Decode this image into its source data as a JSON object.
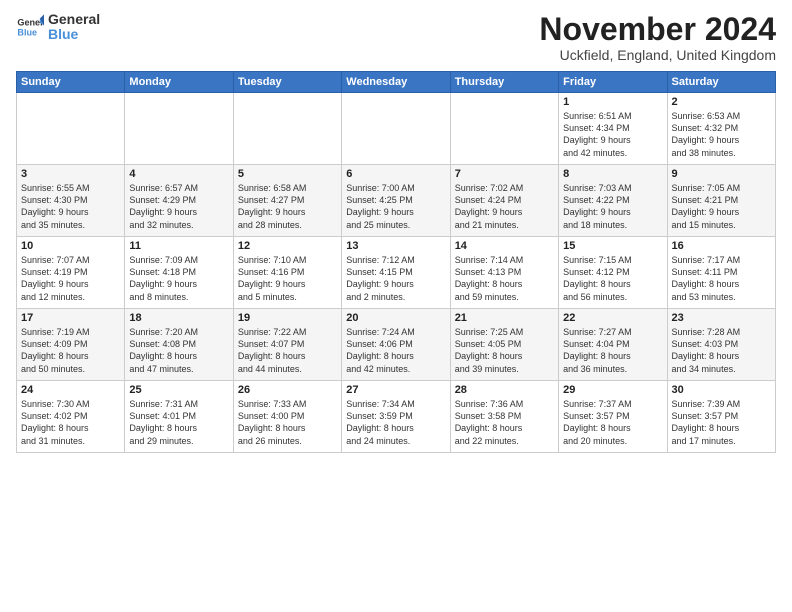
{
  "logo": {
    "line1": "General",
    "line2": "Blue"
  },
  "title": "November 2024",
  "subtitle": "Uckfield, England, United Kingdom",
  "header": {
    "days": [
      "Sunday",
      "Monday",
      "Tuesday",
      "Wednesday",
      "Thursday",
      "Friday",
      "Saturday"
    ]
  },
  "weeks": [
    [
      {
        "day": "",
        "info": ""
      },
      {
        "day": "",
        "info": ""
      },
      {
        "day": "",
        "info": ""
      },
      {
        "day": "",
        "info": ""
      },
      {
        "day": "",
        "info": ""
      },
      {
        "day": "1",
        "info": "Sunrise: 6:51 AM\nSunset: 4:34 PM\nDaylight: 9 hours\nand 42 minutes."
      },
      {
        "day": "2",
        "info": "Sunrise: 6:53 AM\nSunset: 4:32 PM\nDaylight: 9 hours\nand 38 minutes."
      }
    ],
    [
      {
        "day": "3",
        "info": "Sunrise: 6:55 AM\nSunset: 4:30 PM\nDaylight: 9 hours\nand 35 minutes."
      },
      {
        "day": "4",
        "info": "Sunrise: 6:57 AM\nSunset: 4:29 PM\nDaylight: 9 hours\nand 32 minutes."
      },
      {
        "day": "5",
        "info": "Sunrise: 6:58 AM\nSunset: 4:27 PM\nDaylight: 9 hours\nand 28 minutes."
      },
      {
        "day": "6",
        "info": "Sunrise: 7:00 AM\nSunset: 4:25 PM\nDaylight: 9 hours\nand 25 minutes."
      },
      {
        "day": "7",
        "info": "Sunrise: 7:02 AM\nSunset: 4:24 PM\nDaylight: 9 hours\nand 21 minutes."
      },
      {
        "day": "8",
        "info": "Sunrise: 7:03 AM\nSunset: 4:22 PM\nDaylight: 9 hours\nand 18 minutes."
      },
      {
        "day": "9",
        "info": "Sunrise: 7:05 AM\nSunset: 4:21 PM\nDaylight: 9 hours\nand 15 minutes."
      }
    ],
    [
      {
        "day": "10",
        "info": "Sunrise: 7:07 AM\nSunset: 4:19 PM\nDaylight: 9 hours\nand 12 minutes."
      },
      {
        "day": "11",
        "info": "Sunrise: 7:09 AM\nSunset: 4:18 PM\nDaylight: 9 hours\nand 8 minutes."
      },
      {
        "day": "12",
        "info": "Sunrise: 7:10 AM\nSunset: 4:16 PM\nDaylight: 9 hours\nand 5 minutes."
      },
      {
        "day": "13",
        "info": "Sunrise: 7:12 AM\nSunset: 4:15 PM\nDaylight: 9 hours\nand 2 minutes."
      },
      {
        "day": "14",
        "info": "Sunrise: 7:14 AM\nSunset: 4:13 PM\nDaylight: 8 hours\nand 59 minutes."
      },
      {
        "day": "15",
        "info": "Sunrise: 7:15 AM\nSunset: 4:12 PM\nDaylight: 8 hours\nand 56 minutes."
      },
      {
        "day": "16",
        "info": "Sunrise: 7:17 AM\nSunset: 4:11 PM\nDaylight: 8 hours\nand 53 minutes."
      }
    ],
    [
      {
        "day": "17",
        "info": "Sunrise: 7:19 AM\nSunset: 4:09 PM\nDaylight: 8 hours\nand 50 minutes."
      },
      {
        "day": "18",
        "info": "Sunrise: 7:20 AM\nSunset: 4:08 PM\nDaylight: 8 hours\nand 47 minutes."
      },
      {
        "day": "19",
        "info": "Sunrise: 7:22 AM\nSunset: 4:07 PM\nDaylight: 8 hours\nand 44 minutes."
      },
      {
        "day": "20",
        "info": "Sunrise: 7:24 AM\nSunset: 4:06 PM\nDaylight: 8 hours\nand 42 minutes."
      },
      {
        "day": "21",
        "info": "Sunrise: 7:25 AM\nSunset: 4:05 PM\nDaylight: 8 hours\nand 39 minutes."
      },
      {
        "day": "22",
        "info": "Sunrise: 7:27 AM\nSunset: 4:04 PM\nDaylight: 8 hours\nand 36 minutes."
      },
      {
        "day": "23",
        "info": "Sunrise: 7:28 AM\nSunset: 4:03 PM\nDaylight: 8 hours\nand 34 minutes."
      }
    ],
    [
      {
        "day": "24",
        "info": "Sunrise: 7:30 AM\nSunset: 4:02 PM\nDaylight: 8 hours\nand 31 minutes."
      },
      {
        "day": "25",
        "info": "Sunrise: 7:31 AM\nSunset: 4:01 PM\nDaylight: 8 hours\nand 29 minutes."
      },
      {
        "day": "26",
        "info": "Sunrise: 7:33 AM\nSunset: 4:00 PM\nDaylight: 8 hours\nand 26 minutes."
      },
      {
        "day": "27",
        "info": "Sunrise: 7:34 AM\nSunset: 3:59 PM\nDaylight: 8 hours\nand 24 minutes."
      },
      {
        "day": "28",
        "info": "Sunrise: 7:36 AM\nSunset: 3:58 PM\nDaylight: 8 hours\nand 22 minutes."
      },
      {
        "day": "29",
        "info": "Sunrise: 7:37 AM\nSunset: 3:57 PM\nDaylight: 8 hours\nand 20 minutes."
      },
      {
        "day": "30",
        "info": "Sunrise: 7:39 AM\nSunset: 3:57 PM\nDaylight: 8 hours\nand 17 minutes."
      }
    ]
  ]
}
